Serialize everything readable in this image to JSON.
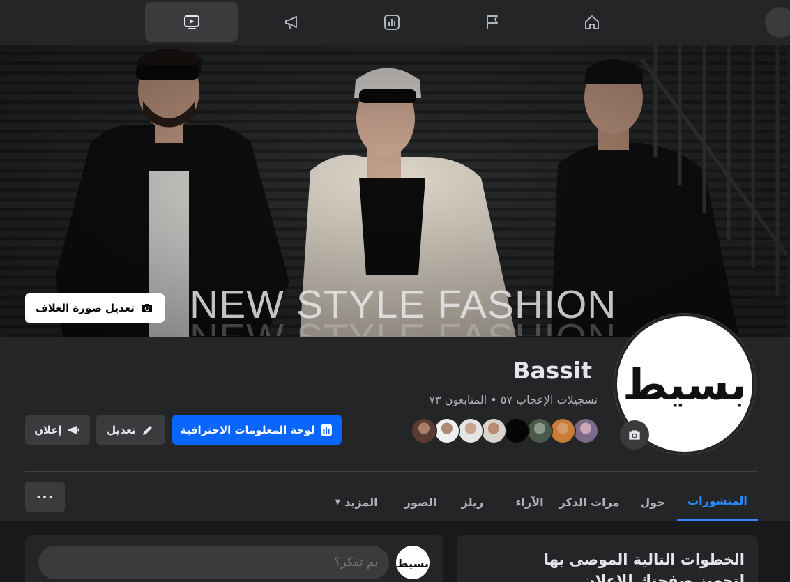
{
  "nav": {
    "tabs": [
      {
        "icon": "video-icon",
        "active": true
      },
      {
        "icon": "megaphone-icon",
        "active": false
      },
      {
        "icon": "insights-icon",
        "active": false
      },
      {
        "icon": "flag-icon",
        "active": false
      },
      {
        "icon": "home-icon",
        "active": false
      }
    ]
  },
  "cover": {
    "text": "NEW STYLE FASHION",
    "edit_label": "تعديل صورة الغلاف"
  },
  "profile": {
    "name": "Bassit",
    "stats": "تسجيلات الإعجاب ٥٧ • المتابعون ٧٣",
    "logo_text": "بسيط"
  },
  "actions": {
    "dashboard_label": "لوحة المعلومات الاحترافية",
    "edit_label": "تعديل",
    "ad_label": "إعلان"
  },
  "tabs": {
    "posts": "المنشورات",
    "about": "حول",
    "mentions": "مرات الذكر",
    "reviews": "الآراء",
    "reels": "ريلز",
    "photos": "الصور",
    "more": "المزيد",
    "overflow": "···"
  },
  "composer": {
    "placeholder": "بم تفكر؟"
  },
  "steps": {
    "title": "الخطوات التالية الموصى بها لتجهيز صفحتك للإعلان"
  },
  "colors": {
    "accent": "#0866ff",
    "tab_active": "#2d88ff",
    "surface": "#242526",
    "background": "#18191a"
  }
}
